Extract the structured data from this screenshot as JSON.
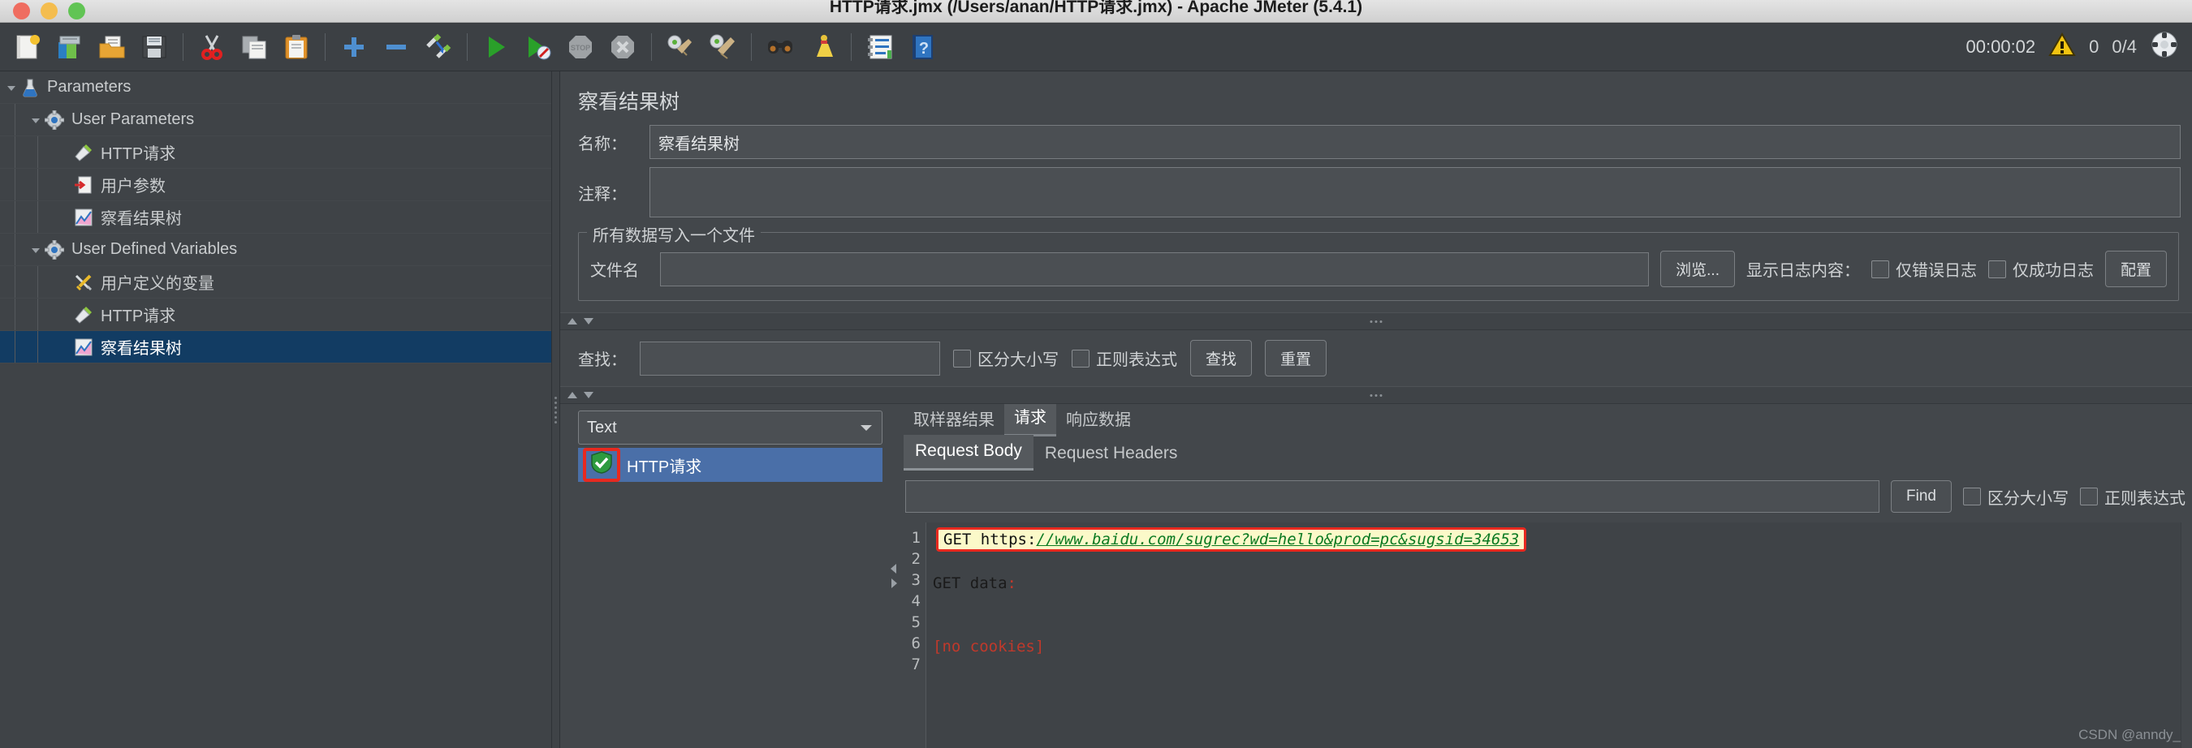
{
  "window": {
    "title": "HTTP请求.jmx (/Users/anan/HTTP请求.jmx) - Apache JMeter (5.4.1)"
  },
  "toolbar": {
    "icons": [
      {
        "name": "new-file-icon",
        "glyph": "🗋"
      },
      {
        "name": "templates-icon",
        "glyph": "📚"
      },
      {
        "name": "open-folder-icon",
        "glyph": "📂"
      },
      {
        "name": "save-icon",
        "glyph": "💾"
      },
      {
        "name": "cut-icon",
        "glyph": "✂"
      },
      {
        "name": "copy-icon",
        "glyph": "⧉"
      },
      {
        "name": "paste-icon",
        "glyph": "📋"
      },
      {
        "name": "expand-all-icon",
        "glyph": "+"
      },
      {
        "name": "collapse-all-icon",
        "glyph": "−"
      },
      {
        "name": "toggle-icon",
        "glyph": "✎"
      },
      {
        "name": "start-icon",
        "glyph": "▶"
      },
      {
        "name": "start-no-pauses-icon",
        "glyph": "▶"
      },
      {
        "name": "stop-icon",
        "glyph": "STOP"
      },
      {
        "name": "shutdown-icon",
        "glyph": "✕"
      },
      {
        "name": "clear-icon",
        "glyph": "🧹"
      },
      {
        "name": "clear-all-icon",
        "glyph": "🧹"
      },
      {
        "name": "search-icon",
        "glyph": "🔍"
      },
      {
        "name": "reset-search-icon",
        "glyph": "🧹"
      },
      {
        "name": "function-helper-icon",
        "glyph": "≣"
      },
      {
        "name": "help-icon",
        "glyph": "?"
      }
    ],
    "status": {
      "elapsed": "00:00:02",
      "warning_icon": "warning-triangle-icon",
      "warning_count": "0",
      "threads": "0/4",
      "remote_icon": "remote-engines-icon"
    }
  },
  "tree": {
    "items": [
      {
        "label": "Parameters",
        "icon": "test-plan-icon",
        "depth": 0,
        "twisty": "down",
        "selected": false
      },
      {
        "label": "User Parameters",
        "icon": "thread-group-icon",
        "depth": 1,
        "twisty": "down",
        "selected": false
      },
      {
        "label": "HTTP请求",
        "icon": "http-sampler-icon",
        "depth": 2,
        "twisty": "",
        "selected": false
      },
      {
        "label": "用户参数",
        "icon": "user-parameters-icon",
        "depth": 2,
        "twisty": "",
        "selected": false
      },
      {
        "label": "察看结果树",
        "icon": "view-results-tree-icon",
        "depth": 2,
        "twisty": "",
        "selected": false
      },
      {
        "label": "User Defined Variables",
        "icon": "thread-group-icon",
        "depth": 1,
        "twisty": "down",
        "selected": false
      },
      {
        "label": "用户定义的变量",
        "icon": "user-defined-variables-icon",
        "depth": 2,
        "twisty": "",
        "selected": false
      },
      {
        "label": "HTTP请求",
        "icon": "http-sampler-icon",
        "depth": 2,
        "twisty": "",
        "selected": false
      },
      {
        "label": "察看结果树",
        "icon": "view-results-tree-icon",
        "depth": 2,
        "twisty": "",
        "selected": true
      }
    ]
  },
  "panel": {
    "title": "察看结果树",
    "name_label": "名称：",
    "name_value": "察看结果树",
    "comment_label": "注释：",
    "comment_value": "",
    "group_legend": "所有数据写入一个文件",
    "filename_label": "文件名",
    "filename_value": "",
    "browse_button": "浏览...",
    "show_log_label": "显示日志内容：",
    "errors_only_label": "仅错误日志",
    "success_only_label": "仅成功日志",
    "configure_button": "配置"
  },
  "search": {
    "label": "查找：",
    "value": "",
    "case_sensitive_label": "区分大小写",
    "regex_label": "正则表达式",
    "find_button": "查找",
    "reset_button": "重置"
  },
  "results": {
    "renderer_selected": "Text",
    "entries": [
      {
        "label": "HTTP请求",
        "icon": "success-shield-icon",
        "selected": true,
        "annotated": true
      }
    ]
  },
  "tabs": {
    "main": [
      {
        "label": "取样器结果",
        "active": false
      },
      {
        "label": "请求",
        "active": true
      },
      {
        "label": "响应数据",
        "active": false
      }
    ],
    "sub": [
      {
        "label": "Request Body",
        "active": true
      },
      {
        "label": "Request Headers",
        "active": false
      }
    ]
  },
  "find_bar": {
    "value": "",
    "find_button": "Find",
    "case_sensitive_label": "区分大小写",
    "regex_label": "正则表达式"
  },
  "code": {
    "line_numbers": [
      "1",
      "2",
      "3",
      "4",
      "5",
      "6",
      "7"
    ],
    "line1_method": "GET https:",
    "line1_url": "//www.baidu.com/sugrec?wd=hello&prod=pc&sugsid=34653",
    "line3": "GET data",
    "line3_colon": ":",
    "line6": "[no cookies]"
  },
  "watermark": "CSDN @anndy_"
}
